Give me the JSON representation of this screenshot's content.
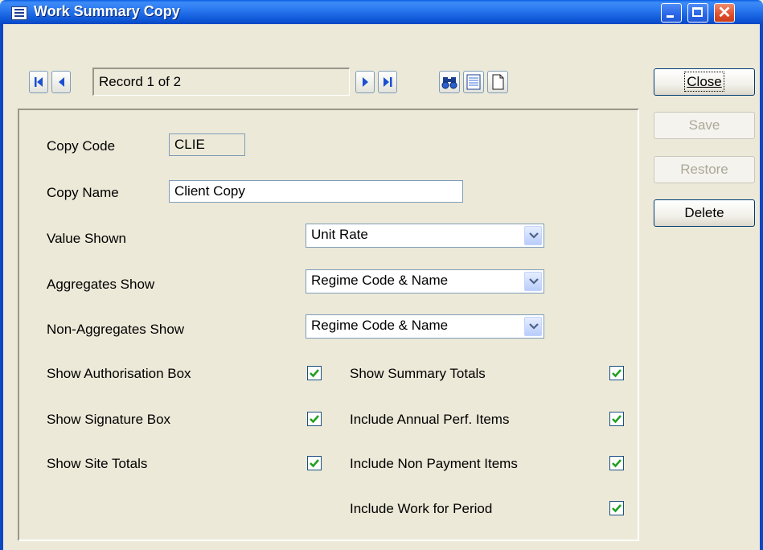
{
  "window": {
    "title": "Work Summary Copy"
  },
  "navigator": {
    "first_glyph": "K",
    "prev_glyph": "◀",
    "record_text": "Record 1 of 2",
    "next_glyph": "▶",
    "last_glyph": "M"
  },
  "form": {
    "copy_code_label": "Copy Code",
    "copy_code_value": "CLIE",
    "copy_name_label": "Copy Name",
    "copy_name_value": "Client Copy",
    "value_shown_label": "Value Shown",
    "value_shown_value": "Unit Rate",
    "aggregates_label": "Aggregates Show",
    "aggregates_value": "Regime Code & Name",
    "non_aggregates_label": "Non-Aggregates Show",
    "non_aggregates_value": "Regime Code & Name",
    "checkboxes": [
      {
        "label": "Show Authorisation Box",
        "checked": true
      },
      {
        "label": "Show Signature Box",
        "checked": true
      },
      {
        "label": "Show Site Totals",
        "checked": true
      },
      {
        "label": "Show Summary Totals",
        "checked": true
      },
      {
        "label": "Include Annual Perf. Items",
        "checked": true
      },
      {
        "label": "Include Non Payment Items",
        "checked": true
      },
      {
        "label": "Include Work for Period",
        "checked": true
      }
    ]
  },
  "buttons": {
    "close": "Close",
    "save": "Save",
    "restore": "Restore",
    "delete": "Delete"
  },
  "colors": {
    "titlebar": "#0a5ee6",
    "face": "#ece9d8",
    "accent": "#1a4fcf",
    "check": "#21a121"
  }
}
